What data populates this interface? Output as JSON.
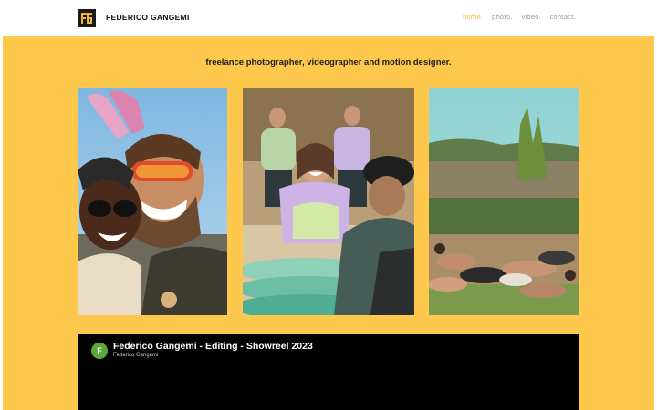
{
  "header": {
    "logo_text": "FG",
    "brand": "FEDERICO GANGEMI",
    "nav": [
      {
        "label": "home.",
        "active": true
      },
      {
        "label": "photo.",
        "active": false
      },
      {
        "label": "video.",
        "active": false
      },
      {
        "label": "contact.",
        "active": false
      }
    ]
  },
  "main": {
    "background_color": "#fdc84b",
    "tagline": "freelance photographer, videographer and motion designer.",
    "photos": [
      {
        "subject": "two smiling people with sunglasses and bunny ears"
      },
      {
        "subject": "smiling woman kneeling on surfboards in a surf class"
      },
      {
        "subject": "group of people lying on the ground in a field"
      }
    ],
    "video": {
      "avatar_letter": "F",
      "title": "Federico Gangemi - Editing - Showreel 2023",
      "channel": "Federico Gangemi"
    }
  },
  "colors": {
    "accent": "#f2b632",
    "nav_text": "#9a9a9a"
  }
}
